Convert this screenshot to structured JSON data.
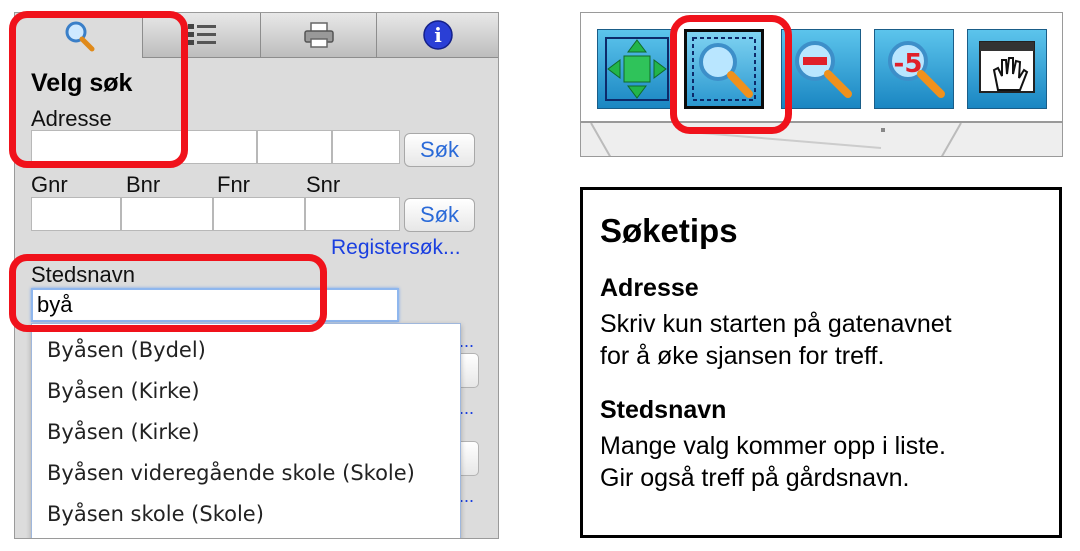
{
  "search_panel": {
    "tabs": [
      {
        "name": "search-tab",
        "icon": "magnifier-icon",
        "active": true
      },
      {
        "name": "layers-tab",
        "icon": "layers-list-icon",
        "active": false
      },
      {
        "name": "print-tab",
        "icon": "printer-icon",
        "active": false
      },
      {
        "name": "info-tab",
        "icon": "info-icon",
        "active": false
      }
    ],
    "title": "Velg søk",
    "adresse_label": "Adresse",
    "adresse_button": "Søk",
    "matrikkel_labels": {
      "gnr": "Gnr",
      "bnr": "Bnr",
      "fnr": "Fnr",
      "snr": "Snr"
    },
    "matrikkel_button": "Søk",
    "register_link": "Registersøk...",
    "stedsnavn_label": "Stedsnavn",
    "stedsnavn_value": "byå",
    "more_dots": "...",
    "suggestions": [
      "Byåsen (Bydel)",
      "Byåsen (Kirke)",
      "Byåsen (Kirke)",
      "Byåsen videregående skole (Skole)",
      "Byåsen skole (Skole)"
    ]
  },
  "toolbar": {
    "buttons": [
      {
        "name": "zoom-extent-button",
        "icon": "zoom-extent-icon"
      },
      {
        "name": "zoom-box-button",
        "icon": "zoom-box-icon",
        "active": true
      },
      {
        "name": "zoom-out-button",
        "icon": "zoom-out-icon"
      },
      {
        "name": "zoom-previous-button",
        "icon": "zoom-previous-icon"
      },
      {
        "name": "pan-button",
        "icon": "pan-hand-icon"
      }
    ]
  },
  "tips": {
    "title": "Søketips",
    "adresse_heading": "Adresse",
    "adresse_lines": [
      "Skriv kun starten på gatenavnet",
      "for å øke sjansen for treff."
    ],
    "stedsnavn_heading": "Stedsnavn",
    "stedsnavn_lines": [
      "Mange valg kommer opp i liste.",
      "Gir også treff på gårdsnavn."
    ]
  },
  "colors": {
    "highlight": "#f0121b",
    "link": "#1a3fe0",
    "button_text": "#2a6ad8",
    "toolbar_blue": "#2a97cf"
  }
}
